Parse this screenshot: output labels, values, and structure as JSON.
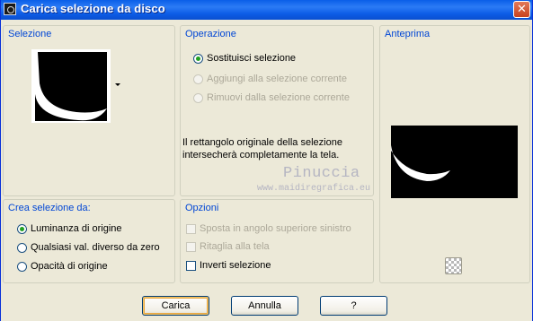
{
  "window": {
    "title": "Carica selezione da disco",
    "close": "✕"
  },
  "selection_group": {
    "title": "Selezione"
  },
  "operation_group": {
    "title": "Operazione",
    "options": [
      {
        "label": "Sostituisci selezione",
        "checked": true,
        "enabled": true
      },
      {
        "label": "Aggiungi alla selezione corrente",
        "checked": false,
        "enabled": false
      },
      {
        "label": "Rimuovi dalla selezione corrente",
        "checked": false,
        "enabled": false
      }
    ],
    "info_line1": "Il rettangolo originale della selezione",
    "info_line2": "intersecherà completamente la tela."
  },
  "preview_group": {
    "title": "Anteprima"
  },
  "create_group": {
    "title": "Crea selezione da:",
    "options": [
      {
        "label": "Luminanza di origine",
        "checked": true
      },
      {
        "label": "Qualsiasi val. diverso da zero",
        "checked": false
      },
      {
        "label": "Opacità di origine",
        "checked": false
      }
    ]
  },
  "options_group": {
    "title": "Opzioni",
    "items": [
      {
        "label": "Sposta in angolo superiore sinistro",
        "checked": false,
        "enabled": false
      },
      {
        "label": "Ritaglia alla tela",
        "checked": false,
        "enabled": false
      },
      {
        "label": "Inverti selezione",
        "checked": false,
        "enabled": true
      }
    ]
  },
  "watermark": {
    "name": "Pinuccia",
    "url": "www.maidiregrafica.eu"
  },
  "buttons": {
    "load": "Carica",
    "cancel": "Annulla",
    "help": "?"
  }
}
